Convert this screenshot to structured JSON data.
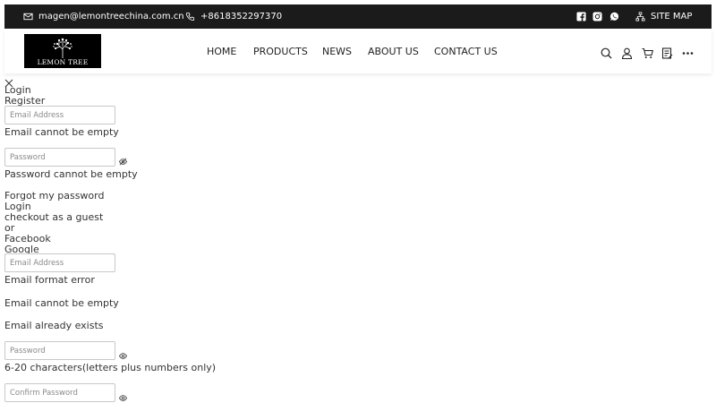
{
  "topbar": {
    "email": "magen@lemontreechina.com.cn",
    "phone": "+8618352297370",
    "sitemap": "SITE MAP"
  },
  "header": {
    "logo_text": "LEMON TREE",
    "nav": [
      "HOME",
      "PRODUCTS",
      "NEWS",
      "ABOUT US",
      "CONTACT US"
    ]
  },
  "login": {
    "tab_login": "Login",
    "tab_register": "Register",
    "email_placeholder": "Email Address",
    "email_error": "Email cannot be empty",
    "password_placeholder": "Password",
    "password_error": "Password cannot be empty",
    "forgot": "Forgot my password",
    "submit": "Login",
    "guest": "checkout as a guest",
    "or": "or",
    "facebook": "Facebook",
    "google": "Google"
  },
  "register": {
    "email_placeholder": "Email Address",
    "email_format_error": "Email format error",
    "email_empty_error": "Email cannot be empty",
    "email_exists_error": "Email already exists",
    "password_placeholder": "Password",
    "password_hint": "6-20 characters(letters plus numbers only)",
    "confirm_placeholder": "Confirm Password"
  }
}
